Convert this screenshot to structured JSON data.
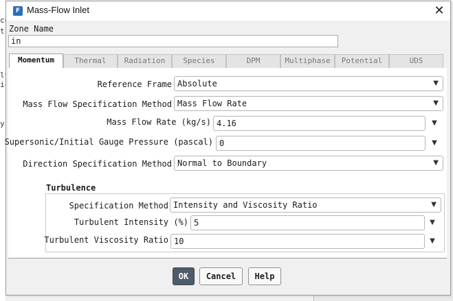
{
  "background": {
    "left_fragments": [
      "cu",
      "t",
      "ly",
      "ic",
      "y"
    ]
  },
  "dialog": {
    "title": "Mass-Flow Inlet",
    "app_icon_letter": "F",
    "close_glyph": "✕",
    "zone_name_label": "Zone Name",
    "zone_name_value": "in",
    "tabs": [
      {
        "label": "Momentum",
        "active": true
      },
      {
        "label": "Thermal",
        "active": false
      },
      {
        "label": "Radiation",
        "active": false
      },
      {
        "label": "Species",
        "active": false
      },
      {
        "label": "DPM",
        "active": false
      },
      {
        "label": "Multiphase",
        "active": false
      },
      {
        "label": "Potential",
        "active": false
      },
      {
        "label": "UDS",
        "active": false
      }
    ],
    "momentum": {
      "reference_frame_label": "Reference Frame",
      "reference_frame_value": "Absolute",
      "mass_flow_spec_label": "Mass Flow Specification Method",
      "mass_flow_spec_value": "Mass Flow Rate",
      "mass_flow_rate_label": "Mass Flow Rate (kg/s)",
      "mass_flow_rate_value": "4.16",
      "gauge_pressure_label": "Supersonic/Initial Gauge Pressure (pascal)",
      "gauge_pressure_value": "0",
      "direction_spec_label": "Direction Specification Method",
      "direction_spec_value": "Normal to Boundary"
    },
    "turbulence": {
      "heading": "Turbulence",
      "spec_method_label": "Specification Method",
      "spec_method_value": "Intensity and Viscosity Ratio",
      "intensity_label": "Turbulent Intensity (%)",
      "intensity_value": "5",
      "viscosity_ratio_label": "Turbulent Viscosity Ratio",
      "viscosity_ratio_value": "10"
    },
    "buttons": {
      "ok": "OK",
      "cancel": "Cancel",
      "help": "Help"
    },
    "icons": {
      "chevron_down": "▼"
    },
    "colors": {
      "primary_button": "#4d5b6a",
      "app_icon": "#2a6fb8"
    }
  }
}
